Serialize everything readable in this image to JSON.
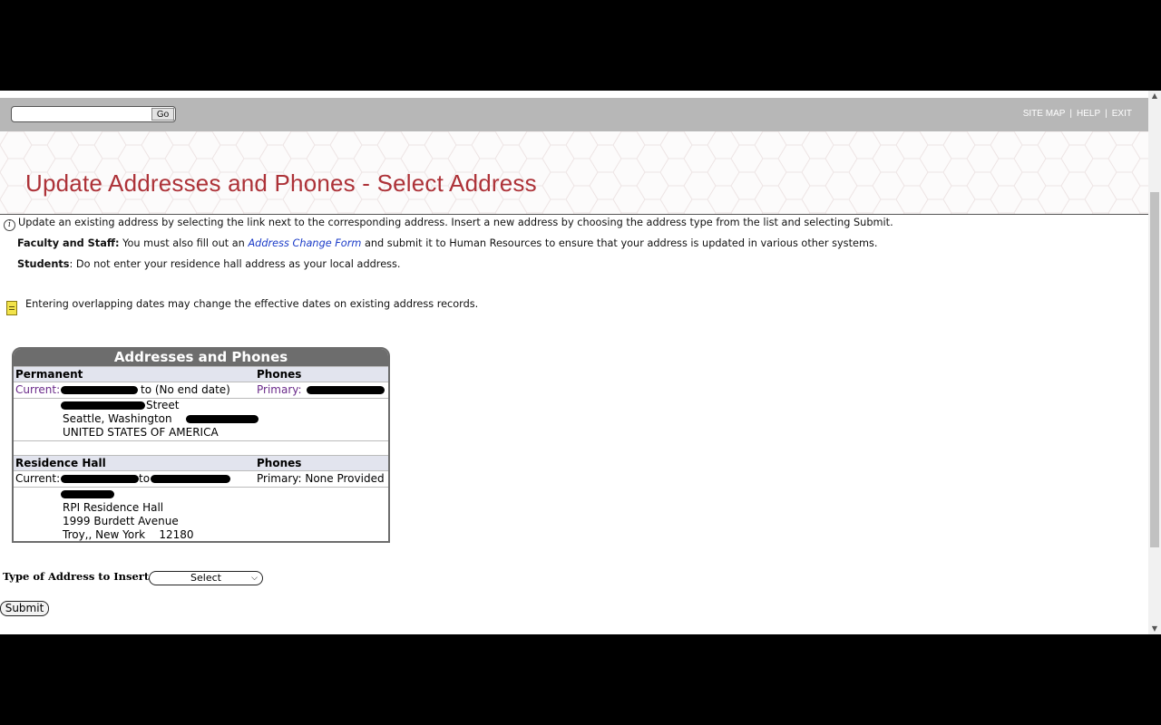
{
  "topbar": {
    "search_placeholder": "",
    "go_label": "Go",
    "links": [
      "SITE MAP",
      "HELP",
      "EXIT"
    ],
    "separator": "|"
  },
  "header": {
    "title": "Update Addresses and Phones - Select Address"
  },
  "info": {
    "icon": "info-icon",
    "text": "Update an existing address by selecting the link next to the corresponding address. Insert a new address by choosing the address type from the list and selecting Submit.",
    "faculty_label": "Faculty and Staff:",
    "faculty_pre": " You must also fill out an ",
    "faculty_link": "Address Change Form",
    "faculty_post": " and submit it to Human Resources to ensure that your address is updated in various other systems.",
    "students_label": "Students",
    "students_text": ": Do not enter your residence hall address as your local address."
  },
  "note": {
    "icon": "note-icon",
    "text": "Entering overlapping dates may change the effective dates on existing address records."
  },
  "addresses": {
    "title": "Addresses and Phones",
    "permanent": {
      "heading": "Permanent",
      "phones_heading": "Phones",
      "current_label": "Current:",
      "range_text": "to (No end date)",
      "primary_label": "Primary:",
      "street_suffix": "Street",
      "city_line": "Seattle, Washington",
      "country": "UNITED STATES OF AMERICA"
    },
    "residence": {
      "heading": "Residence Hall",
      "phones_heading": "Phones",
      "current_label": "Current:",
      "to_text": "to",
      "primary_text": "Primary: None Provided",
      "line1": "RPI Residence Hall",
      "line2": "1999 Burdett Avenue",
      "line3": "Troy,, New York    12180"
    }
  },
  "form": {
    "type_label": "Type of Address to Insert:",
    "select_value": "Select",
    "submit_label": "Submit"
  },
  "colors": {
    "title": "#ad3238",
    "topbar": "#b7b7b7",
    "table_header": "#6d6d6d",
    "section_bg": "#e2e4ee",
    "link": "#1a3bc8",
    "purple": "#6a2a8a"
  }
}
